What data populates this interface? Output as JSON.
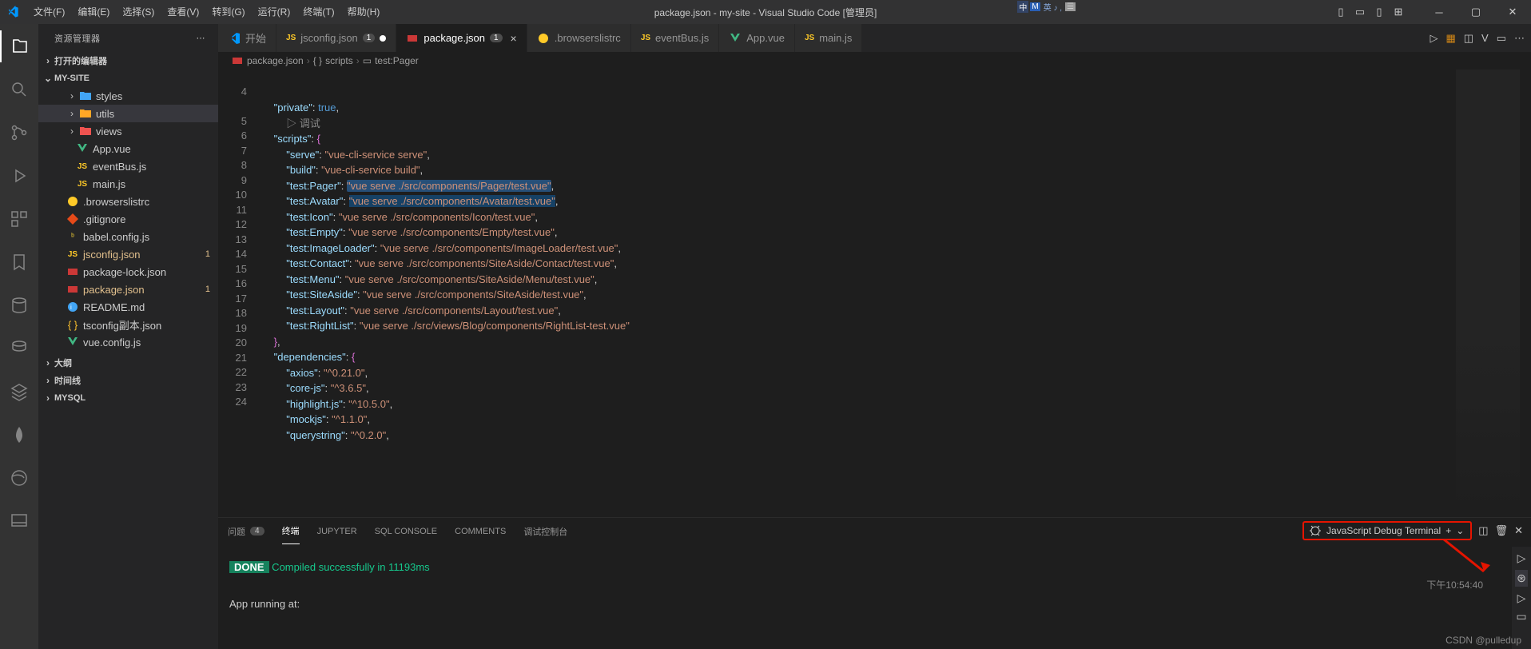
{
  "title": "package.json - my-site - Visual Studio Code [管理员]",
  "menu": [
    "文件(F)",
    "编辑(E)",
    "选择(S)",
    "查看(V)",
    "转到(G)",
    "运行(R)",
    "终端(T)",
    "帮助(H)"
  ],
  "sidebar": {
    "title": "资源管理器",
    "open_editors": "打开的编辑器",
    "project": "MY-SITE",
    "folders": {
      "styles": "styles",
      "utils": "utils",
      "views": "views"
    },
    "files": {
      "app": "App.vue",
      "eventbus": "eventBus.js",
      "main": "main.js",
      "browserslist": ".browserslistrc",
      "gitignore": ".gitignore",
      "babel": "babel.config.js",
      "jsconfig": "jsconfig.json",
      "pkglock": "package-lock.json",
      "pkg": "package.json",
      "readme": "README.md",
      "tsconfig": "tsconfig副本.json",
      "vueconfig": "vue.config.js"
    },
    "badges": {
      "jsconfig": "1",
      "pkg": "1"
    },
    "sections": {
      "outline": "大纲",
      "timeline": "时间线",
      "mysql": "MYSQL"
    }
  },
  "tabs": {
    "start": "开始",
    "jsconfig": {
      "label": "jsconfig.json",
      "badge": "1"
    },
    "package": {
      "label": "package.json",
      "badge": "1"
    },
    "browsers": ".browserslistrc",
    "eventbus": "eventBus.js",
    "app": "App.vue",
    "main": "main.js"
  },
  "breadcrumb": {
    "file": "package.json",
    "scripts": "scripts",
    "test": "test:Pager"
  },
  "code": {
    "line3_end": "},",
    "debug_label": "▷ 调试",
    "private": "\"private\"",
    "true": "true",
    "scripts": "\"scripts\"",
    "serve_k": "\"serve\"",
    "serve_v": "\"vue-cli-service serve\"",
    "build_k": "\"build\"",
    "build_v": "\"vue-cli-service build\"",
    "pager_k": "\"test:Pager\"",
    "pager_v": "\"vue serve ./src/components/Pager/test.vue\"",
    "avatar_k": "\"test:Avatar\"",
    "avatar_v": "\"vue serve ./src/components/Avatar/test.vue\"",
    "icon_k": "\"test:Icon\"",
    "icon_v": "\"vue serve ./src/components/Icon/test.vue\"",
    "empty_k": "\"test:Empty\"",
    "empty_v": "\"vue serve ./src/components/Empty/test.vue\"",
    "imgl_k": "\"test:ImageLoader\"",
    "imgl_v": "\"vue serve ./src/components/ImageLoader/test.vue\"",
    "contact_k": "\"test:Contact\"",
    "contact_v": "\"vue serve ./src/components/SiteAside/Contact/test.vue\"",
    "menu_k": "\"test:Menu\"",
    "menu_v": "\"vue serve ./src/components/SiteAside/Menu/test.vue\"",
    "aside_k": "\"test:SiteAside\"",
    "aside_v": "\"vue serve ./src/components/SiteAside/test.vue\"",
    "layout_k": "\"test:Layout\"",
    "layout_v": "\"vue serve ./src/components/Layout/test.vue\"",
    "right_k": "\"test:RightList\"",
    "right_v": "\"vue serve ./src/views/Blog/components/RightList-test.vue\"",
    "deps": "\"dependencies\"",
    "axios_k": "\"axios\"",
    "axios_v": "\"^0.21.0\"",
    "corejs_k": "\"core-js\"",
    "corejs_v": "\"^3.6.5\"",
    "hljs_k": "\"highlight.js\"",
    "hljs_v": "\"^10.5.0\"",
    "mock_k": "\"mockjs\"",
    "mock_v": "\"^1.1.0\"",
    "qs_k": "\"querystring\"",
    "qs_v": "\"^0.2.0\""
  },
  "lines": [
    "4",
    "5",
    "6",
    "7",
    "8",
    "9",
    "10",
    "11",
    "12",
    "13",
    "14",
    "15",
    "16",
    "17",
    "18",
    "19",
    "20",
    "21",
    "22",
    "23",
    "24"
  ],
  "panel": {
    "tabs": {
      "problems": "问题",
      "problems_count": "4",
      "terminal": "终端",
      "jupyter": "JUPYTER",
      "sqlconsole": "SQL CONSOLE",
      "comments": "COMMENTS",
      "debugconsole": "调试控制台"
    },
    "js_debug": "JavaScript Debug Terminal",
    "done": "DONE",
    "compiled": " Compiled successfully in 11193ms",
    "time": "下午10:54:40",
    "running": "App running at:"
  },
  "watermark": "CSDN @pulledup"
}
